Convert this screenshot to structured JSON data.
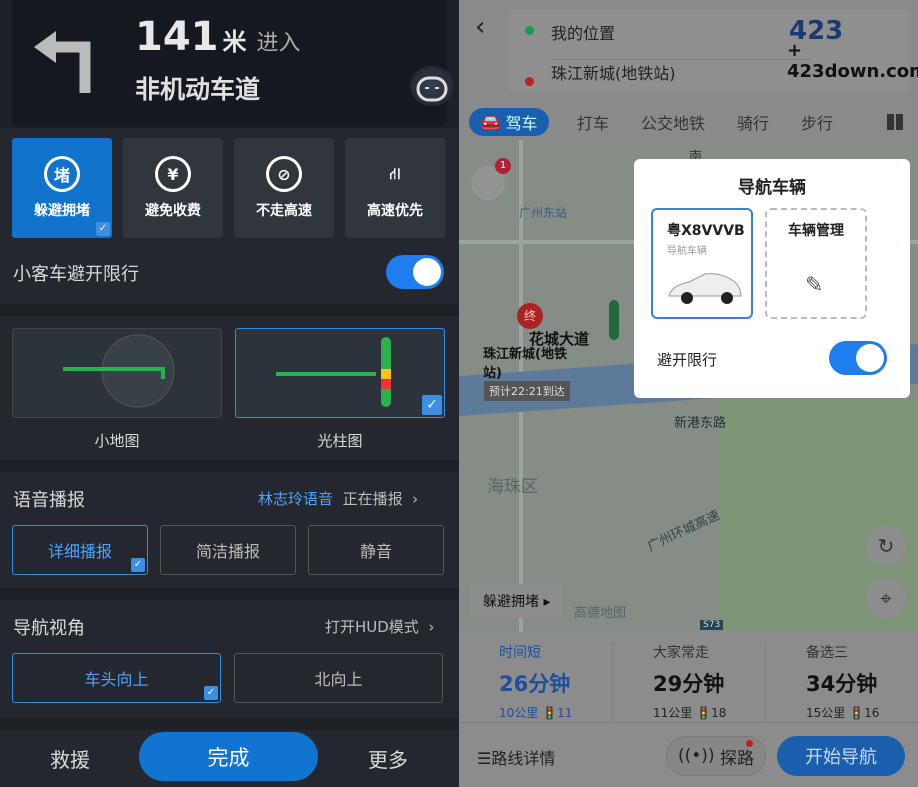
{
  "left": {
    "guidance": {
      "distance": "141",
      "unit": "米",
      "action": "进入",
      "road": "非机动车道"
    },
    "prefs": [
      {
        "icon": "堵",
        "label": "躲避拥堵",
        "selected": true
      },
      {
        "icon": "¥",
        "label": "避免收费",
        "selected": false
      },
      {
        "icon": "⊘",
        "label": "不走高速",
        "selected": false
      },
      {
        "icon": "⛙",
        "label": "高速优先",
        "selected": false
      }
    ],
    "avoid_limit": {
      "label": "小客车避开限行",
      "on": true
    },
    "map_styles": [
      {
        "label": "小地图",
        "selected": false
      },
      {
        "label": "光柱图",
        "selected": true
      }
    ],
    "voice": {
      "title": "语音播报",
      "voice_name": "林志玲语音",
      "status": "正在播报",
      "options": [
        {
          "label": "详细播报",
          "selected": true
        },
        {
          "label": "简洁播报",
          "selected": false
        },
        {
          "label": "静音",
          "selected": false
        }
      ]
    },
    "view": {
      "title": "导航视角",
      "hud": "打开HUD模式",
      "options": [
        {
          "label": "车头向上",
          "selected": true
        },
        {
          "label": "北向上",
          "selected": false
        }
      ]
    },
    "bottom": {
      "rescue": "救援",
      "done": "完成",
      "more": "更多"
    }
  },
  "right": {
    "origin": "我的位置",
    "destination": "珠江新城(地铁站)",
    "watermark": "423down.com",
    "modes": [
      "驾车",
      "打车",
      "公交地铁",
      "骑行",
      "步行"
    ],
    "map_labels": {
      "station": "广州东站",
      "end_marker": "终",
      "road1": "花城大道",
      "dest": "珠江新城(地铁站)",
      "eta": "预计22:21到达",
      "road2": "新港东路",
      "district": "海珠区",
      "road3": "广州环城高速",
      "compass": "南",
      "brand": "高德地图",
      "highway": "S73",
      "badge": "1"
    },
    "avoid_btn": "躲避拥堵",
    "popup": {
      "title": "导航车辆",
      "plate": "粤X8VVVB",
      "plate_sub": "导航车辆",
      "manage": "车辆管理",
      "avoid_label": "避开限行",
      "on": true
    },
    "routes": [
      {
        "label": "时间短",
        "time": "26分钟",
        "dist": "10公里",
        "lights": "11",
        "selected": true
      },
      {
        "label": "大家常走",
        "time": "29分钟",
        "dist": "11公里",
        "lights": "18"
      },
      {
        "label": "备选三",
        "time": "34分钟",
        "dist": "15公里",
        "lights": "16"
      }
    ],
    "details": "路线详情",
    "explore": "探路",
    "start": "开始导航"
  }
}
